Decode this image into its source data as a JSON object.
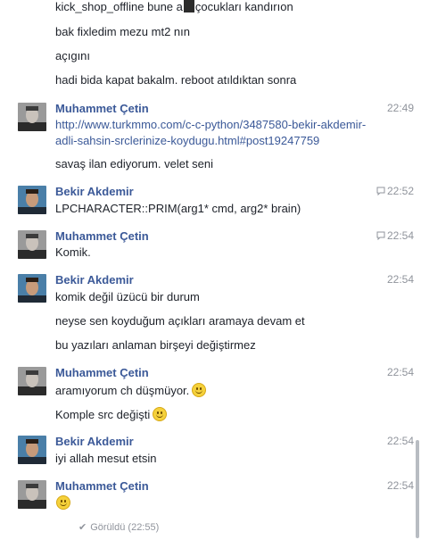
{
  "messages": {
    "m0": "kick_shop_offline bune a",
    "m0b": "çocukları kandırıon",
    "m1": "bak fixledim mezu mt2 nın",
    "m2": "açıgını",
    "m3": "hadi bida kapat bakalm. reboot atıldıktan sonra",
    "link_l1": "http://www.turkmmo.com/c-c-python/3487580-bekir-akdemir-",
    "link_l2": "adli-sahsin-srclerinize-koydugu.html#post19247759",
    "m4": "savaş ilan ediyorum. velet seni",
    "m5": "LPCHARACTER::PRIM(arg1* cmd, arg2* brain)",
    "m6": "Komik.",
    "m7": "komik değil üzücü bir durum",
    "m8": "neyse sen koyduğum açıkları aramaya devam et",
    "m9": "bu yazıları anlaman birşeyi değiştirmez",
    "m10": "aramıyorum ch düşmüyor.",
    "m11": "Komple src değişti",
    "m12": "iyi allah mesut etsin"
  },
  "names": {
    "muhammet": "Muhammet Çetin",
    "bekir": "Bekir Akdemir"
  },
  "times": {
    "t1": "22:49",
    "t2": "22:52",
    "t3": "22:54",
    "t4": "22:54",
    "t5": "22:54",
    "t6": "22:54",
    "t7": "22:54"
  },
  "seen": "Görüldü (22:55)",
  "colors": {
    "name": "#3b5998",
    "link": "#3b5998",
    "time": "#90949c",
    "text": "#1d2129"
  },
  "icons": {
    "seen_time": "speech-bubble-icon",
    "emoji": "smiley-emoji-icon",
    "seen": "checkmark-icon"
  }
}
